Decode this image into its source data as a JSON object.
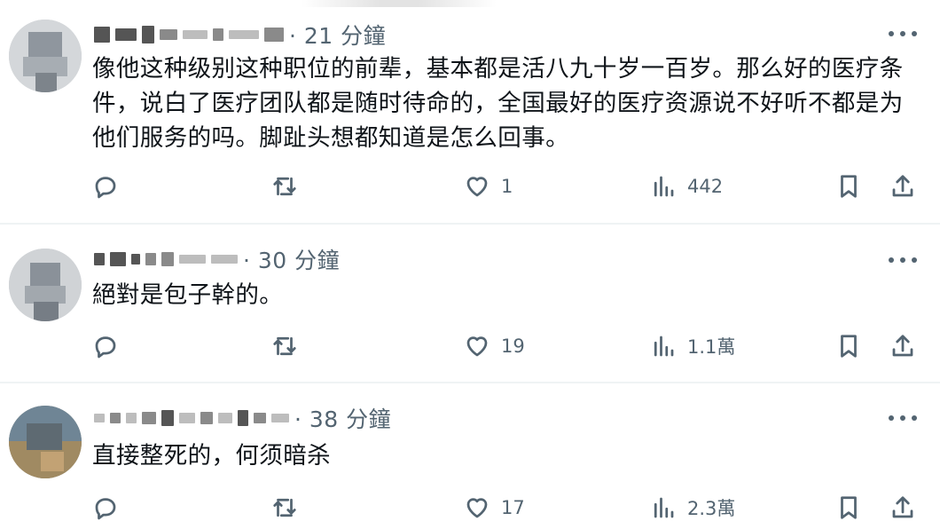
{
  "posts": [
    {
      "time": "21 分鐘",
      "text": "像他这种级别这种职位的前辈，基本都是活八九十岁一百岁。那么好的医疗条件，说白了医疗团队都是随时待命的，全国最好的医疗资源说不好听不都是为他们服务的吗。脚趾头想都知道是怎么回事。",
      "replies": "",
      "reposts": "",
      "likes": "1",
      "views": "442"
    },
    {
      "time": "30 分鐘",
      "text": "絕對是包子幹的。",
      "replies": "",
      "reposts": "",
      "likes": "19",
      "views": "1.1萬"
    },
    {
      "time": "38 分鐘",
      "text": "直接整死的，何须暗杀",
      "replies": "",
      "reposts": "",
      "likes": "17",
      "views": "2.3萬"
    }
  ],
  "separator": "·",
  "icons": {
    "reply": "reply-icon",
    "repost": "repost-icon",
    "like": "heart-icon",
    "views": "views-icon",
    "bookmark": "bookmark-icon",
    "share": "share-icon",
    "more": "more-icon"
  },
  "colors": {
    "text": "#0f1419",
    "secondary": "#536471",
    "divider": "#eff3f4"
  }
}
